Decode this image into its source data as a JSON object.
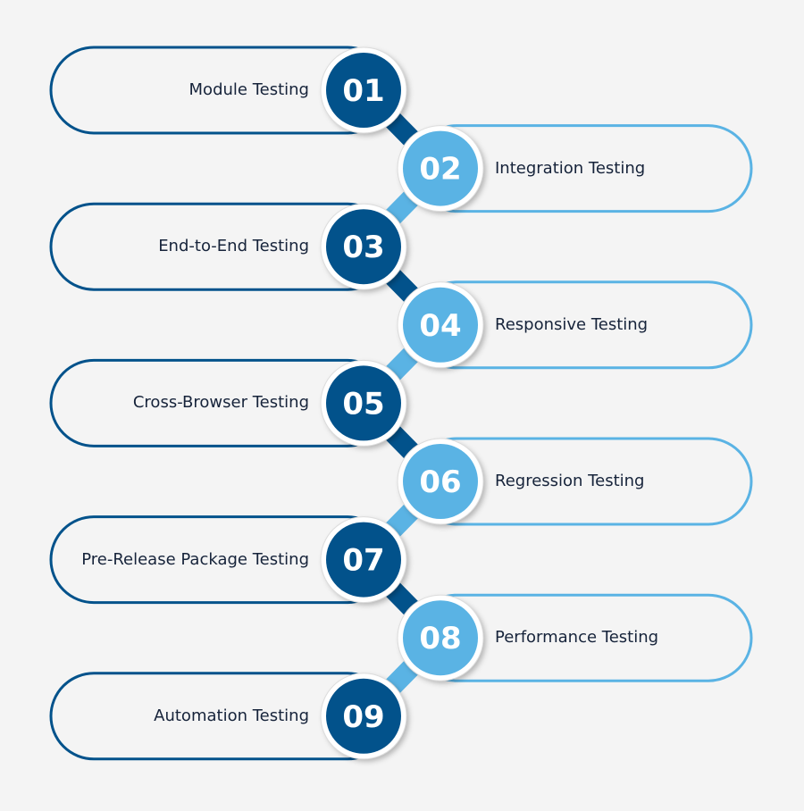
{
  "colors": {
    "dark": "#02528b",
    "light": "#5ab3e4",
    "text": "#16233a",
    "background": "#f4f4f4"
  },
  "steps": [
    {
      "number": "01",
      "label": "Module Testing",
      "side": "left"
    },
    {
      "number": "02",
      "label": "Integration Testing",
      "side": "right"
    },
    {
      "number": "03",
      "label": "End-to-End Testing",
      "side": "left"
    },
    {
      "number": "04",
      "label": "Responsive Testing",
      "side": "right"
    },
    {
      "number": "05",
      "label": "Cross-Browser Testing",
      "side": "left"
    },
    {
      "number": "06",
      "label": "Regression Testing",
      "side": "right"
    },
    {
      "number": "07",
      "label": "Pre-Release Package Testing",
      "side": "left"
    },
    {
      "number": "08",
      "label": "Performance Testing",
      "side": "right"
    },
    {
      "number": "09",
      "label": "Automation Testing",
      "side": "left"
    }
  ]
}
